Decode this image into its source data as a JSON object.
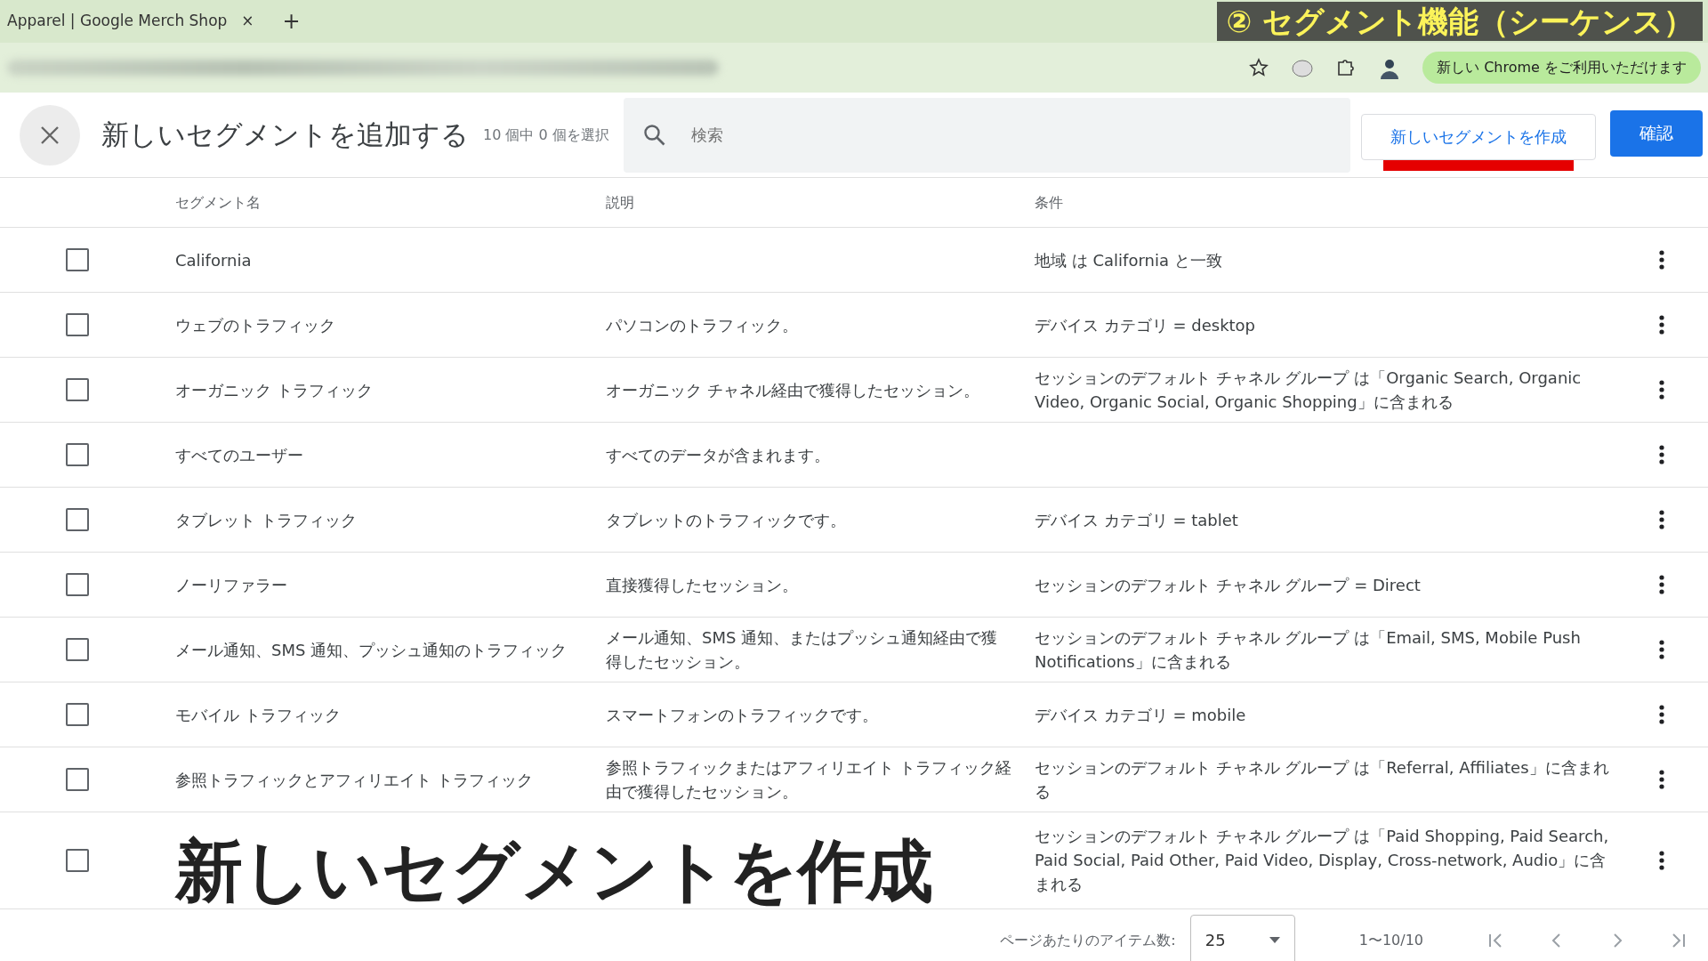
{
  "browser": {
    "tab_title": "Apparel | Google Merch Shop",
    "tab_close": "×",
    "new_tab": "+",
    "update_notice": "新しい Chrome をご利用いただけます"
  },
  "banner": "② セグメント機能（シーケンス）",
  "dialog": {
    "title": "新しいセグメントを追加する",
    "selection_count": "10 個中 0 個を選択",
    "search": {
      "placeholder": "検索"
    },
    "create_button": "新しいセグメントを作成",
    "confirm_button": "確認"
  },
  "table": {
    "columns": [
      "セグメント名",
      "説明",
      "条件"
    ],
    "rows": [
      {
        "checked": false,
        "name": "California",
        "description": "",
        "condition": "地域 は California と一致"
      },
      {
        "checked": false,
        "name": "ウェブのトラフィック",
        "description": "パソコンのトラフィック。",
        "condition": "デバイス カテゴリ = desktop"
      },
      {
        "checked": false,
        "name": "オーガニック トラフィック",
        "description": "オーガニック チャネル経由で獲得したセッション。",
        "condition": "セッションのデフォルト チャネル グループ は「Organic Search, Organic Video, Organic Social, Organic Shopping」に含まれる"
      },
      {
        "checked": false,
        "name": "すべてのユーザー",
        "description": "すべてのデータが含まれます。",
        "condition": ""
      },
      {
        "checked": false,
        "name": "タブレット トラフィック",
        "description": "タブレットのトラフィックです。",
        "condition": "デバイス カテゴリ = tablet"
      },
      {
        "checked": false,
        "name": "ノーリファラー",
        "description": "直接獲得したセッション。",
        "condition": "セッションのデフォルト チャネル グループ = Direct"
      },
      {
        "checked": false,
        "name": "メール通知、SMS 通知、プッシュ通知のトラフィック",
        "description": "メール通知、SMS 通知、またはプッシュ通知経由で獲得したセッション。",
        "condition": "セッションのデフォルト チャネル グループ は「Email, SMS, Mobile Push Notifications」に含まれる"
      },
      {
        "checked": false,
        "name": "モバイル トラフィック",
        "description": "スマートフォンのトラフィックです。",
        "condition": "デバイス カテゴリ = mobile"
      },
      {
        "checked": false,
        "name": "参照トラフィックとアフィリエイト トラフィック",
        "description": "参照トラフィックまたはアフィリエイト トラフィック経由で獲得したセッション。",
        "condition": "セッションのデフォルト チャネル グループ は「Referral, Affiliates」に含まれる"
      },
      {
        "checked": false,
        "name": "",
        "description": "",
        "condition": "セッションのデフォルト チャネル グループ は「Paid Shopping, Paid Search, Paid Social, Paid Other, Paid Video, Display, Cross-network, Audio」に含まれる"
      }
    ]
  },
  "caption": "新しいセグメントを作成",
  "pagination": {
    "per_page_label": "ページあたりのアイテム数:",
    "per_page": "25",
    "range": "1〜10/10"
  }
}
